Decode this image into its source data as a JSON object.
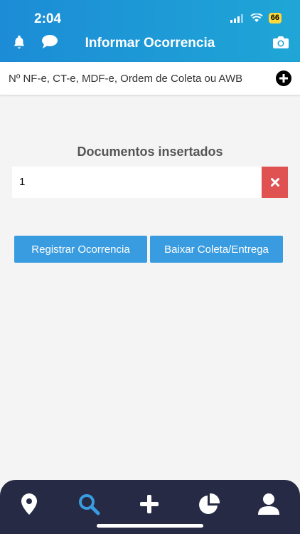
{
  "status_bar": {
    "time": "2:04",
    "battery": "66"
  },
  "header": {
    "title": "Informar Ocorrencia"
  },
  "search": {
    "placeholder": "Nº NF-e, CT-e, MDF-e, Ordem de Coleta ou AWB"
  },
  "documents": {
    "heading": "Documentos insertados",
    "items": [
      {
        "value": "1"
      }
    ]
  },
  "actions": {
    "register_label": "Registrar Ocorrencia",
    "download_label": "Baixar Coleta/Entrega"
  },
  "tabbar": {
    "active": "search",
    "colors": {
      "active": "#3a9ce0",
      "inactive": "#ffffff",
      "background": "#262a45"
    }
  },
  "colors": {
    "header": "#1c8cd6",
    "primary_button": "#3a9ce0",
    "delete": "#e05252"
  }
}
